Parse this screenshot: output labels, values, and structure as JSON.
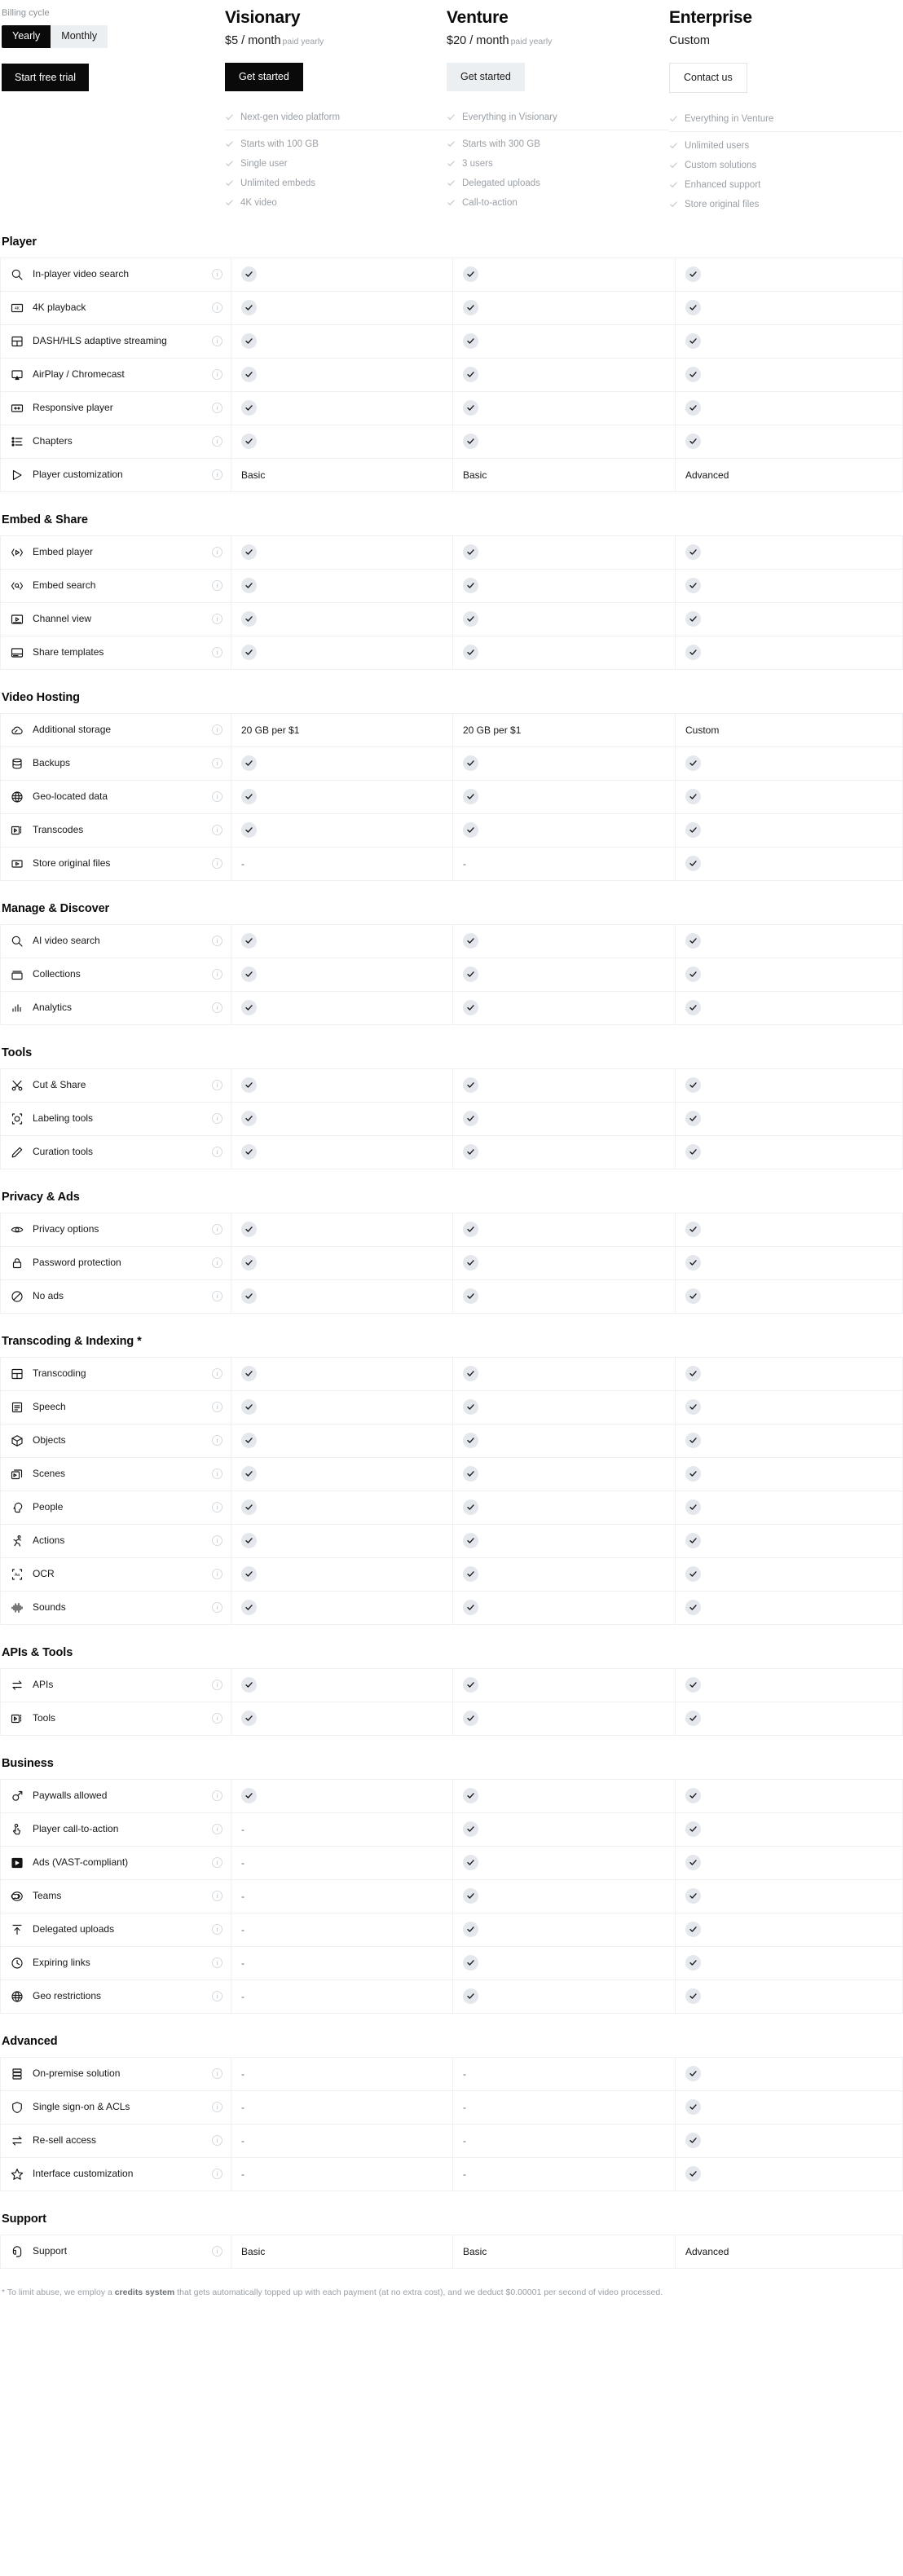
{
  "billing": {
    "label": "Billing cycle",
    "options": [
      {
        "label": "Yearly",
        "active": true
      },
      {
        "label": "Monthly",
        "active": false
      }
    ],
    "trial_button": "Start free trial"
  },
  "plans": [
    {
      "name": "Visionary",
      "price": "$5 / month",
      "period": "paid yearly",
      "cta": "Get started",
      "cta_style": "primary",
      "features": [
        "Next-gen video platform",
        "Starts with 100 GB",
        "Single user",
        "Unlimited embeds",
        "4K video"
      ]
    },
    {
      "name": "Venture",
      "price": "$20 / month",
      "period": "paid yearly",
      "cta": "Get started",
      "cta_style": "secondary",
      "features": [
        "Everything in Visionary",
        "Starts with 300 GB",
        "3 users",
        "Delegated uploads",
        "Call-to-action"
      ]
    },
    {
      "name": "Enterprise",
      "price": "Custom",
      "period": "",
      "cta": "Contact us",
      "cta_style": "outline",
      "features": [
        "Everything in Venture",
        "Unlimited users",
        "Custom solutions",
        "Enhanced support",
        "Store original files"
      ]
    }
  ],
  "sections": [
    {
      "title": "Player",
      "rows": [
        {
          "icon": "search-icon",
          "label": "In-player video search",
          "values": [
            "check",
            "check",
            "check"
          ]
        },
        {
          "icon": "4k-icon",
          "label": "4K playback",
          "values": [
            "check",
            "check",
            "check"
          ]
        },
        {
          "icon": "adaptive-streaming-icon",
          "label": "DASH/HLS adaptive streaming",
          "values": [
            "check",
            "check",
            "check"
          ]
        },
        {
          "icon": "cast-icon",
          "label": "AirPlay / Chromecast",
          "values": [
            "check",
            "check",
            "check"
          ]
        },
        {
          "icon": "responsive-icon",
          "label": "Responsive player",
          "values": [
            "check",
            "check",
            "check"
          ]
        },
        {
          "icon": "list-icon",
          "label": "Chapters",
          "values": [
            "check",
            "check",
            "check"
          ]
        },
        {
          "icon": "play-icon",
          "label": "Player customization",
          "values": [
            "Basic",
            "Basic",
            "Advanced"
          ]
        }
      ]
    },
    {
      "title": "Embed & Share",
      "rows": [
        {
          "icon": "embed-code-icon",
          "label": "Embed player",
          "values": [
            "check",
            "check",
            "check"
          ]
        },
        {
          "icon": "embed-search-icon",
          "label": "Embed search",
          "values": [
            "check",
            "check",
            "check"
          ]
        },
        {
          "icon": "channel-icon",
          "label": "Channel view",
          "values": [
            "check",
            "check",
            "check"
          ]
        },
        {
          "icon": "template-icon",
          "label": "Share templates",
          "values": [
            "check",
            "check",
            "check"
          ]
        }
      ]
    },
    {
      "title": "Video Hosting",
      "rows": [
        {
          "icon": "cloud-storage-icon",
          "label": "Additional storage",
          "values": [
            "20 GB per $1",
            "20 GB per $1",
            "Custom"
          ]
        },
        {
          "icon": "database-icon",
          "label": "Backups",
          "values": [
            "check",
            "check",
            "check"
          ]
        },
        {
          "icon": "globe-icon",
          "label": "Geo-located data",
          "values": [
            "check",
            "check",
            "check"
          ]
        },
        {
          "icon": "transcode-icon",
          "label": "Transcodes",
          "values": [
            "check",
            "check",
            "check"
          ]
        },
        {
          "icon": "file-play-icon",
          "label": "Store original files",
          "values": [
            "-",
            "-",
            "check"
          ]
        }
      ]
    },
    {
      "title": "Manage & Discover",
      "rows": [
        {
          "icon": "search-icon",
          "label": "AI video search",
          "values": [
            "check",
            "check",
            "check"
          ]
        },
        {
          "icon": "collections-icon",
          "label": "Collections",
          "values": [
            "check",
            "check",
            "check"
          ]
        },
        {
          "icon": "analytics-icon",
          "label": "Analytics",
          "values": [
            "check",
            "check",
            "check"
          ]
        }
      ]
    },
    {
      "title": "Tools",
      "rows": [
        {
          "icon": "scissors-icon",
          "label": "Cut & Share",
          "values": [
            "check",
            "check",
            "check"
          ]
        },
        {
          "icon": "label-icon",
          "label": "Labeling tools",
          "values": [
            "check",
            "check",
            "check"
          ]
        },
        {
          "icon": "pencil-icon",
          "label": "Curation tools",
          "values": [
            "check",
            "check",
            "check"
          ]
        }
      ]
    },
    {
      "title": "Privacy & Ads",
      "rows": [
        {
          "icon": "eye-icon",
          "label": "Privacy options",
          "values": [
            "check",
            "check",
            "check"
          ]
        },
        {
          "icon": "lock-icon",
          "label": "Password protection",
          "values": [
            "check",
            "check",
            "check"
          ]
        },
        {
          "icon": "no-ads-icon",
          "label": "No ads",
          "values": [
            "check",
            "check",
            "check"
          ]
        }
      ]
    },
    {
      "title": "Transcoding & Indexing *",
      "rows": [
        {
          "icon": "adaptive-streaming-icon",
          "label": "Transcoding",
          "values": [
            "check",
            "check",
            "check"
          ]
        },
        {
          "icon": "speech-icon",
          "label": "Speech",
          "values": [
            "check",
            "check",
            "check"
          ]
        },
        {
          "icon": "cube-icon",
          "label": "Objects",
          "values": [
            "check",
            "check",
            "check"
          ]
        },
        {
          "icon": "scenes-icon",
          "label": "Scenes",
          "values": [
            "check",
            "check",
            "check"
          ]
        },
        {
          "icon": "people-icon",
          "label": "People",
          "values": [
            "check",
            "check",
            "check"
          ]
        },
        {
          "icon": "actions-icon",
          "label": "Actions",
          "values": [
            "check",
            "check",
            "check"
          ]
        },
        {
          "icon": "ocr-icon",
          "label": "OCR",
          "values": [
            "check",
            "check",
            "check"
          ]
        },
        {
          "icon": "sound-wave-icon",
          "label": "Sounds",
          "values": [
            "check",
            "check",
            "check"
          ]
        }
      ]
    },
    {
      "title": "APIs & Tools",
      "rows": [
        {
          "icon": "api-arrows-icon",
          "label": "APIs",
          "values": [
            "check",
            "check",
            "check"
          ]
        },
        {
          "icon": "transcode-icon",
          "label": "Tools",
          "values": [
            "check",
            "check",
            "check"
          ]
        }
      ]
    },
    {
      "title": "Business",
      "rows": [
        {
          "icon": "paywall-icon",
          "label": "Paywalls allowed",
          "values": [
            "check",
            "check",
            "check"
          ]
        },
        {
          "icon": "click-hand-icon",
          "label": "Player call-to-action",
          "values": [
            "-",
            "check",
            "check"
          ]
        },
        {
          "icon": "ads-icon",
          "label": "Ads (VAST-compliant)",
          "values": [
            "-",
            "check",
            "check"
          ]
        },
        {
          "icon": "teams-icon",
          "label": "Teams",
          "values": [
            "-",
            "check",
            "check"
          ]
        },
        {
          "icon": "upload-icon",
          "label": "Delegated uploads",
          "values": [
            "-",
            "check",
            "check"
          ]
        },
        {
          "icon": "clock-icon",
          "label": "Expiring links",
          "values": [
            "-",
            "check",
            "check"
          ]
        },
        {
          "icon": "globe-icon",
          "label": "Geo restrictions",
          "values": [
            "-",
            "check",
            "check"
          ]
        }
      ]
    },
    {
      "title": "Advanced",
      "rows": [
        {
          "icon": "server-icon",
          "label": "On-premise solution",
          "values": [
            "-",
            "-",
            "check"
          ]
        },
        {
          "icon": "shield-icon",
          "label": "Single sign-on & ACLs",
          "values": [
            "-",
            "-",
            "check"
          ]
        },
        {
          "icon": "api-arrows-icon",
          "label": "Re-sell access",
          "values": [
            "-",
            "-",
            "check"
          ]
        },
        {
          "icon": "star-icon",
          "label": "Interface customization",
          "values": [
            "-",
            "-",
            "check"
          ]
        }
      ]
    },
    {
      "title": "Support",
      "rows": [
        {
          "icon": "support-icon",
          "label": "Support",
          "values": [
            "Basic",
            "Basic",
            "Advanced"
          ]
        }
      ]
    }
  ],
  "footnote": {
    "prefix": "* To limit abuse, we employ a ",
    "bold": "credits system",
    "suffix": " that gets automatically topped up with each payment (at no extra cost), and we deduct $0.00001 per second of video processed."
  },
  "colors": {
    "accent": "#0a0a0a",
    "muted": "#9aa0a6",
    "border": "#eef1f3",
    "badge_bg": "#e4e8ec",
    "secondary_btn": "#eceff1"
  }
}
